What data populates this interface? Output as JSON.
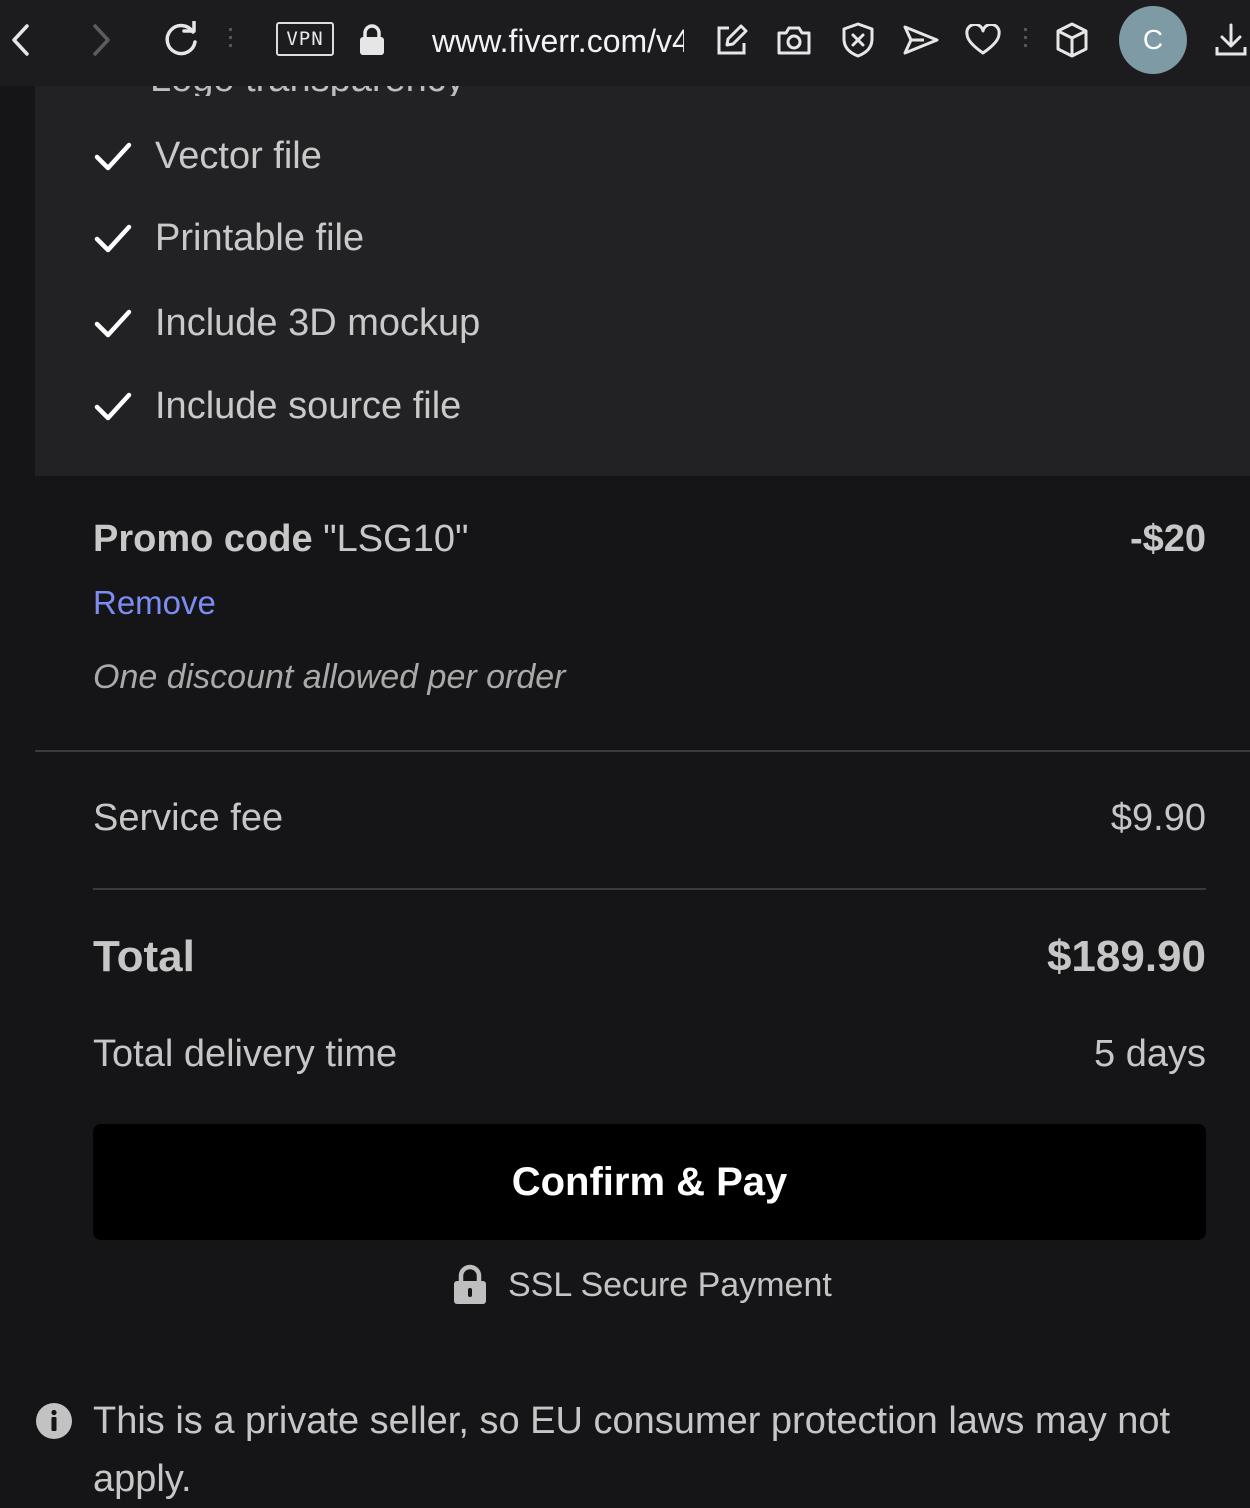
{
  "browser": {
    "url": "www.fiverr.com/v4",
    "vpn_label": "VPN",
    "profile_initial": "C",
    "icons": [
      "back-icon",
      "forward-icon",
      "reload-icon",
      "vpn-badge",
      "lock-icon",
      "edit-icon",
      "camera-icon",
      "shield-x-icon",
      "send-icon",
      "heart-icon",
      "cube-icon",
      "download-icon"
    ]
  },
  "package": {
    "partially_hidden_text": "Logo transparency",
    "features": [
      {
        "label": "Vector file"
      },
      {
        "label": "Printable file"
      },
      {
        "label": "Include 3D mockup"
      },
      {
        "label": "Include source file"
      }
    ]
  },
  "promo": {
    "label_prefix": "Promo code",
    "code": "\"LSG10\"",
    "amount": "-$20",
    "remove_label": "Remove",
    "note": "One discount allowed per order"
  },
  "summary": {
    "service_fee_label": "Service fee",
    "service_fee_value": "$9.90",
    "total_label": "Total",
    "total_value": "$189.90",
    "delivery_label": "Total delivery time",
    "delivery_value": "5 days"
  },
  "actions": {
    "confirm_label": "Confirm & Pay",
    "ssl_label": "SSL Secure Payment"
  },
  "notice": {
    "text": "This is a private seller, so EU consumer protection laws may not apply."
  },
  "colors": {
    "background": "#151517",
    "card": "#222224",
    "link": "#7b8cf2",
    "button": "#000000",
    "avatar": "#7e9aa5"
  }
}
